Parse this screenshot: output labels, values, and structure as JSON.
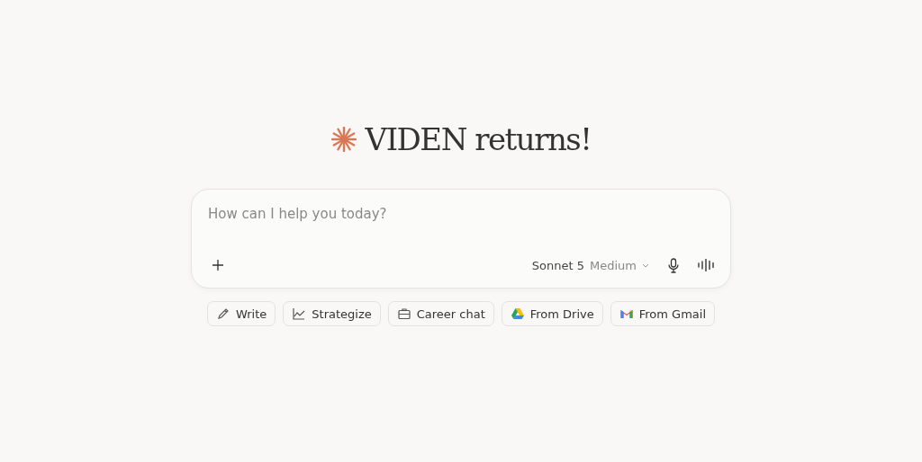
{
  "heading": "VIDEN returns!",
  "composer": {
    "placeholder": "How can I help you today?",
    "model": "Sonnet 5",
    "effort": "Medium"
  },
  "chips": [
    {
      "label": "Write",
      "kind": "pencil"
    },
    {
      "label": "Strategize",
      "kind": "chart"
    },
    {
      "label": "Career chat",
      "kind": "briefcase"
    },
    {
      "label": "From Drive",
      "kind": "drive"
    },
    {
      "label": "From Gmail",
      "kind": "gmail"
    }
  ]
}
